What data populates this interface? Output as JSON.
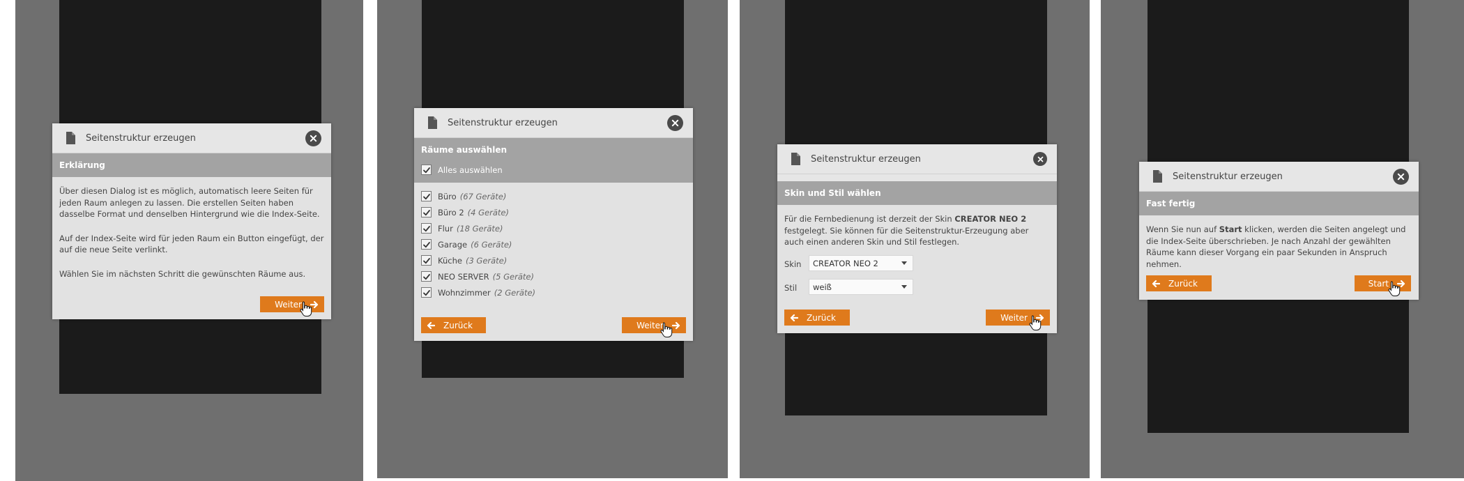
{
  "dialog_title": "Seitenstruktur erzeugen",
  "icons": {
    "document": "document-icon",
    "close": "close-icon",
    "next_arrow": "arrow-right-icon",
    "back_arrow": "arrow-left-icon",
    "cursor": "hand-pointer-icon",
    "check": "checkmark-icon"
  },
  "colors": {
    "accent": "#df7a1c",
    "panel": "#6f6f6f",
    "phone": "#1b1b1b",
    "section": "#a3a3a3",
    "dialog": "#e2e2e2"
  },
  "step1": {
    "section": "Erklärung",
    "paragraphs": [
      "Über diesen Dialog ist es möglich, automatisch leere Seiten für jeden Raum anlegen zu lassen. Die erstellen Seiten haben dasselbe Format und denselben Hintergrund wie die Index-Seite.",
      "Auf der Index-Seite wird für jeden Raum ein Button eingefügt, der auf die neue Seite verlinkt.",
      "Wählen Sie im nächsten Schritt die gewünschten Räume aus."
    ],
    "next_label": "Weiter"
  },
  "step2": {
    "section": "Räume auswählen",
    "select_all": "Alles auswählen",
    "rooms": [
      {
        "name": "Büro",
        "count": "(67 Geräte)"
      },
      {
        "name": "Büro 2",
        "count": "(4 Geräte)"
      },
      {
        "name": "Flur",
        "count": "(18 Geräte)"
      },
      {
        "name": "Garage",
        "count": "(6 Geräte)"
      },
      {
        "name": "Küche",
        "count": "(3 Geräte)"
      },
      {
        "name": "NEO SERVER",
        "count": "(5 Geräte)"
      },
      {
        "name": "Wohnzimmer",
        "count": "(2 Geräte)"
      }
    ],
    "back_label": "Zurück",
    "next_label": "Weiter"
  },
  "step3": {
    "section": "Skin und Stil wählen",
    "text_before": "Für die Fernbedienung ist derzeit der Skin ",
    "text_bold": "CREATOR NEO 2",
    "text_after": " festgelegt. Sie können für die Seitenstruktur-Erzeugung aber auch einen anderen Skin und Stil festlegen.",
    "skin_label": "Skin",
    "skin_value": "CREATOR NEO 2",
    "style_label": "Stil",
    "style_value": "weiß",
    "back_label": "Zurück",
    "next_label": "Weiter"
  },
  "step4": {
    "section": "Fast fertig",
    "text_before": "Wenn Sie nun auf ",
    "text_bold": "Start",
    "text_after": " klicken, werden die Seiten angelegt und die Index-Seite überschrieben. Je nach Anzahl der gewählten Räume kann dieser Vorgang ein paar Sekunden in Anspruch nehmen.",
    "back_label": "Zurück",
    "start_label": "Start"
  }
}
